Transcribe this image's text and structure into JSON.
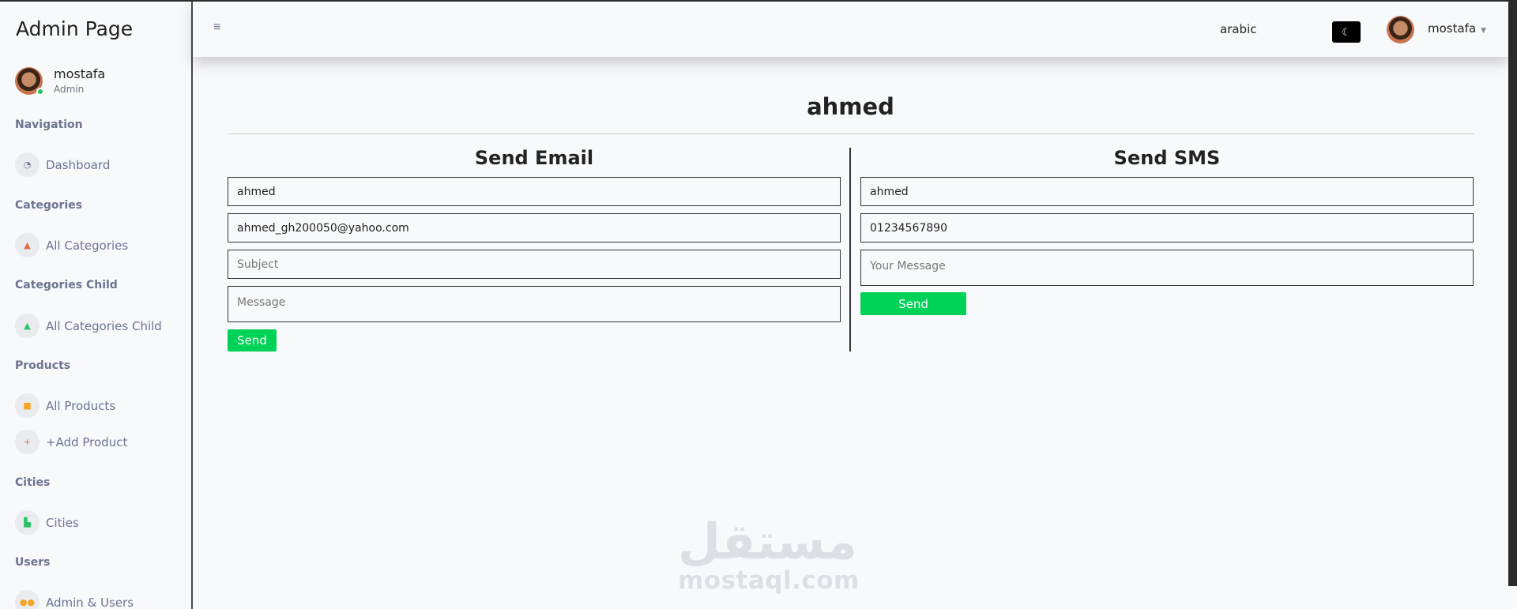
{
  "app": {
    "title": "Admin Page"
  },
  "sidebar": {
    "profile": {
      "name": "mostafa",
      "role": "Admin"
    },
    "sections": [
      {
        "title": "Navigation",
        "items": [
          {
            "label": "Dashboard",
            "icon": "gauge-icon"
          }
        ]
      },
      {
        "title": "Categories",
        "items": [
          {
            "label": "All Categories",
            "icon": "shapes-icon"
          }
        ]
      },
      {
        "title": "Categories Child",
        "items": [
          {
            "label": "All Categories Child",
            "icon": "shapes-child-icon"
          }
        ]
      },
      {
        "title": "Products",
        "items": [
          {
            "label": "All Products",
            "icon": "box-icon"
          },
          {
            "label": "+Add Product",
            "icon": "plus-icon"
          }
        ]
      },
      {
        "title": "Cities",
        "items": [
          {
            "label": "Cities",
            "icon": "building-icon"
          }
        ]
      },
      {
        "title": "Users",
        "items": [
          {
            "label": "Admin & Users",
            "icon": "users-icon"
          }
        ]
      }
    ]
  },
  "header": {
    "menu_icon": "hamburger-icon",
    "language": "arabic",
    "theme_icon": "moon-icon",
    "user_name": "mostafa"
  },
  "main": {
    "title": "ahmed",
    "email_form": {
      "title": "Send Email",
      "name_value": "ahmed",
      "email_value": "ahmed_gh200050@yahoo.com",
      "subject_placeholder": "Subject",
      "message_placeholder": "Message",
      "send_label": "Send"
    },
    "sms_form": {
      "title": "Send SMS",
      "name_value": "ahmed",
      "phone_value": "01234567890",
      "message_placeholder": "Your Message",
      "send_label": "Send"
    }
  },
  "watermark": {
    "arabic": "مستقل",
    "latin": "mostaql.com"
  },
  "colors": {
    "accent_green": "#00d157",
    "nav_text": "#6b7490",
    "online": "#22c55e"
  }
}
